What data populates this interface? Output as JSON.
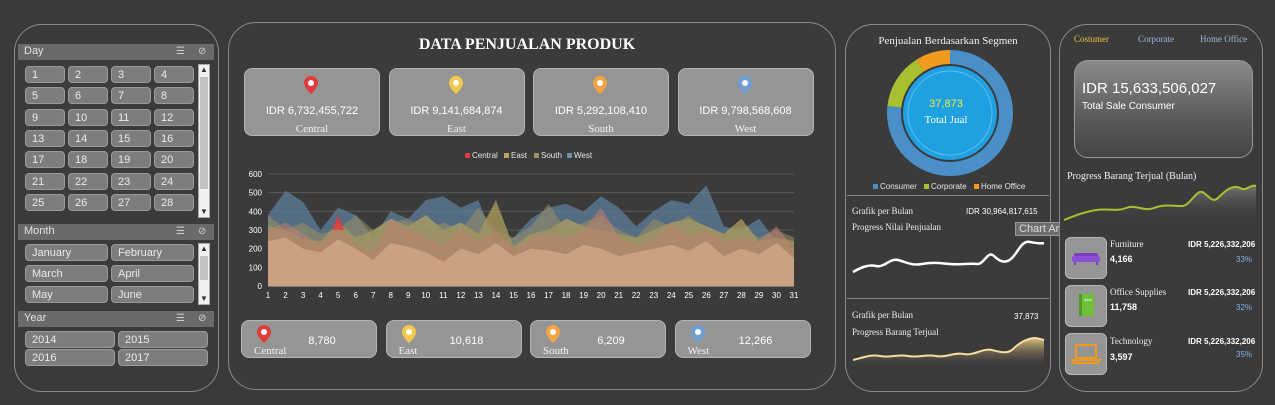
{
  "slicers": {
    "day": {
      "title": "Day",
      "items": [
        "1",
        "2",
        "3",
        "4",
        "5",
        "6",
        "7",
        "8",
        "9",
        "10",
        "11",
        "12",
        "13",
        "14",
        "15",
        "16",
        "17",
        "18",
        "19",
        "20",
        "21",
        "22",
        "23",
        "24",
        "25",
        "26",
        "27",
        "28"
      ]
    },
    "month": {
      "title": "Month",
      "items": [
        "January",
        "February",
        "March",
        "April",
        "May",
        "June"
      ]
    },
    "year": {
      "title": "Year",
      "items": [
        "2014",
        "2015",
        "2016",
        "2017"
      ]
    }
  },
  "main": {
    "title": "DATA PENJUALAN PRODUK",
    "regions": [
      {
        "value": "IDR 6,732,455,722",
        "name": "Central",
        "qty": "8,780",
        "color": "#e03c3c"
      },
      {
        "value": "IDR 9,141,684,874",
        "name": "East",
        "qty": "10,618",
        "color": "#f2c94c"
      },
      {
        "value": "IDR 5,292,108,410",
        "name": "South",
        "qty": "6,209",
        "color": "#f0a545"
      },
      {
        "value": "IDR 9,798,568,608",
        "name": "West",
        "qty": "12,266",
        "color": "#6e9fd0"
      }
    ],
    "legend": [
      "Central",
      "East",
      "South",
      "West"
    ],
    "chart_data": {
      "type": "area",
      "x": [
        1,
        2,
        3,
        4,
        5,
        6,
        7,
        8,
        9,
        10,
        11,
        12,
        13,
        14,
        15,
        16,
        17,
        18,
        19,
        20,
        21,
        22,
        23,
        24,
        25,
        26,
        27,
        28,
        29,
        30,
        31
      ],
      "ylim": [
        0,
        600
      ],
      "yticks": [
        0,
        100,
        200,
        300,
        400,
        500,
        600
      ],
      "series": [
        {
          "name": "West",
          "color": "#5f7f9c",
          "values": [
            380,
            510,
            450,
            300,
            420,
            380,
            260,
            400,
            360,
            460,
            480,
            420,
            460,
            220,
            260,
            360,
            420,
            440,
            400,
            480,
            420,
            320,
            400,
            460,
            440,
            540,
            320,
            300,
            360,
            240,
            180
          ]
        },
        {
          "name": "East",
          "color": "#b7a560",
          "values": [
            320,
            300,
            250,
            240,
            340,
            260,
            300,
            360,
            320,
            380,
            300,
            340,
            280,
            460,
            210,
            280,
            300,
            360,
            320,
            300,
            280,
            260,
            300,
            340,
            360,
            320,
            280,
            360,
            240,
            260,
            240
          ]
        },
        {
          "name": "South",
          "color": "#9a9060",
          "values": [
            380,
            300,
            340,
            280,
            300,
            380,
            300,
            340,
            360,
            300,
            340,
            300,
            420,
            300,
            260,
            320,
            440,
            300,
            340,
            380,
            300,
            260,
            360,
            320,
            380,
            300,
            280,
            320,
            260,
            300,
            260
          ]
        },
        {
          "name": "Central",
          "color": "#c08070",
          "values": [
            300,
            340,
            280,
            220,
            340,
            220,
            180,
            360,
            300,
            260,
            220,
            300,
            240,
            300,
            200,
            260,
            280,
            260,
            300,
            420,
            260,
            220,
            240,
            340,
            260,
            300,
            240,
            260,
            240,
            320,
            200
          ]
        }
      ]
    },
    "chart_center_base": [
      240,
      260,
      200,
      180,
      250,
      200,
      140,
      230,
      210,
      180,
      130,
      200,
      170,
      230,
      160,
      200,
      190,
      170,
      220,
      200,
      160,
      180,
      200,
      220,
      190,
      240,
      160,
      200,
      170,
      230,
      150
    ]
  },
  "segment": {
    "title": "Penjualan Berdasarkan Segmen",
    "center_value": "37,873",
    "center_label": "Total Jual",
    "legend": [
      "Consumer",
      "Corporate",
      "Home Office"
    ],
    "legend_colors": [
      "#4a8fc7",
      "#a8c030",
      "#f09a20"
    ],
    "sales_chart": {
      "title": "Grafik per Bulan",
      "value": "IDR 30,964,817,615",
      "subtitle": "Progress Nilai Penjualan",
      "tooltip": "Chart Area"
    },
    "qty_chart": {
      "title": "Grafik per Bulan",
      "value": "37,873",
      "subtitle": "Progress Barang Terjual"
    }
  },
  "right": {
    "tabs": [
      "Costumer",
      "Corporate",
      "Home Office"
    ],
    "total_value": "IDR 15,633,506,027",
    "total_label": "Total Sale Consumer",
    "progress_title": "Progress Barang Terjual (Bulan)",
    "categories": [
      {
        "name": "Furniture",
        "value": "IDR 5,226,332,206",
        "qty": "4,166",
        "pct": "33%"
      },
      {
        "name": "Office Supplies",
        "value": "IDR 5,226,332,206",
        "qty": "11,758",
        "pct": "32%"
      },
      {
        "name": "Technology",
        "value": "IDR 5,226,332,206",
        "qty": "3,597",
        "pct": "35%"
      }
    ]
  }
}
